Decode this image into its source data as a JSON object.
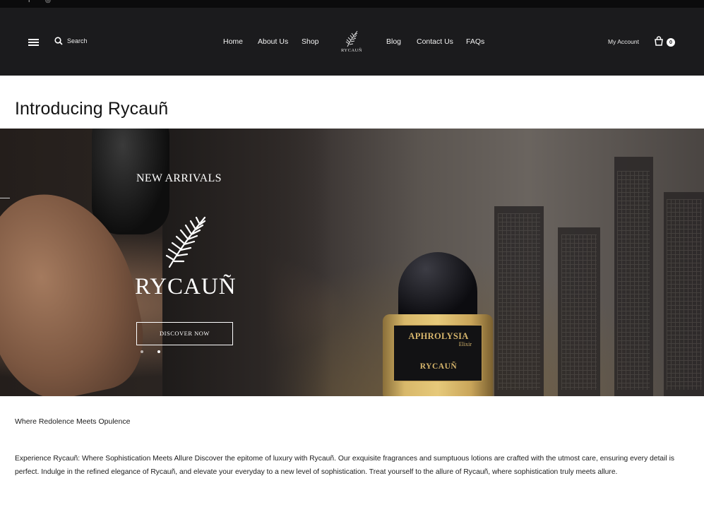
{
  "header": {
    "search_label": "Search",
    "nav_left": [
      "Home",
      "About Us",
      "Shop"
    ],
    "nav_right": [
      "Blog",
      "Contact Us",
      "FAQs"
    ],
    "logo_text": "RYCAUÑ",
    "account_label": "My Account",
    "cart_count": "0"
  },
  "page": {
    "title": "Introducing Rycauñ"
  },
  "hero": {
    "kicker": "NEW ARRIVALS",
    "brand": "RYCAUÑ",
    "cta": "DISCOVER NOW",
    "product_label_line1": "APHROLYSIA",
    "product_label_line2": "Elixir",
    "product_label_line3": "RYCAUÑ",
    "slides": 2,
    "active_slide": 2
  },
  "content": {
    "tagline": "Where Redolence Meets Opulence",
    "body": "Experience Rycauñ: Where Sophistication Meets Allure Discover the epitome of luxury with Rycauñ. Our exquisite fragrances and sumptuous lotions are crafted with the utmost care, ensuring every detail is perfect. Indulge in the refined elegance of Rycauñ, and elevate your everyday to a new level of sophistication. Treat yourself to the allure of Rycauñ, where sophistication truly meets allure."
  },
  "colors": {
    "header_bg": "#1b1b1d",
    "topbar_bg": "#0b0b0c",
    "text_dark": "#1a1a1a",
    "gold": "#d6b56c"
  }
}
